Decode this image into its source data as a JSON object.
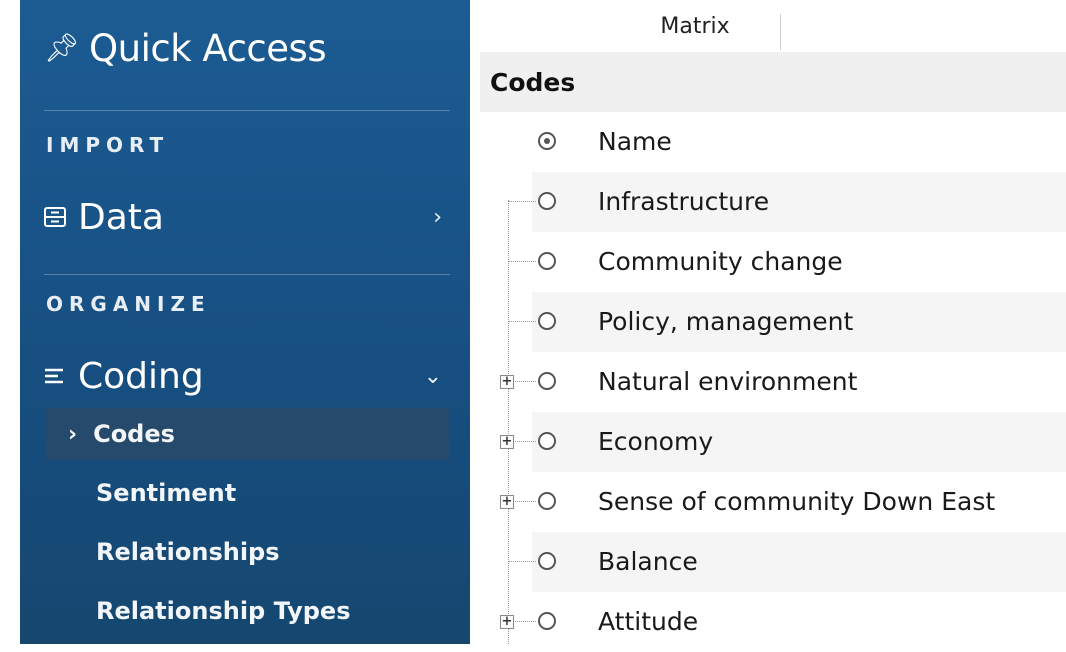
{
  "sidebar": {
    "quick_access": "Quick Access",
    "sections": [
      {
        "title": "IMPORT"
      },
      {
        "title": "ORGANIZE"
      }
    ],
    "data_label": "Data",
    "coding_label": "Coding",
    "coding_items": [
      {
        "label": "Codes",
        "active": true
      },
      {
        "label": "Sentiment"
      },
      {
        "label": "Relationships"
      },
      {
        "label": "Relationship Types"
      }
    ]
  },
  "main": {
    "tab": "Matrix",
    "title": "Codes",
    "column_header": "Name",
    "rows": [
      {
        "name": "Infrastructure",
        "expandable": false
      },
      {
        "name": "Community change",
        "expandable": false
      },
      {
        "name": "Policy, management",
        "expandable": false
      },
      {
        "name": "Natural environment",
        "expandable": true
      },
      {
        "name": "Economy",
        "expandable": true
      },
      {
        "name": "Sense of community Down East",
        "expandable": true
      },
      {
        "name": "Balance",
        "expandable": false
      },
      {
        "name": "Attitude",
        "expandable": true
      }
    ]
  },
  "icons": {
    "pin": "pin-icon",
    "data": "data-grid-icon",
    "coding": "list-icon",
    "chevron_right": "chevron-right-icon",
    "chevron_down": "chevron-down-icon"
  },
  "colors": {
    "sidebar": "#1c5c93",
    "sidebar_active": "#264a6c",
    "header_bg": "#f0f0f0",
    "alt_row": "#f5f5f5"
  }
}
